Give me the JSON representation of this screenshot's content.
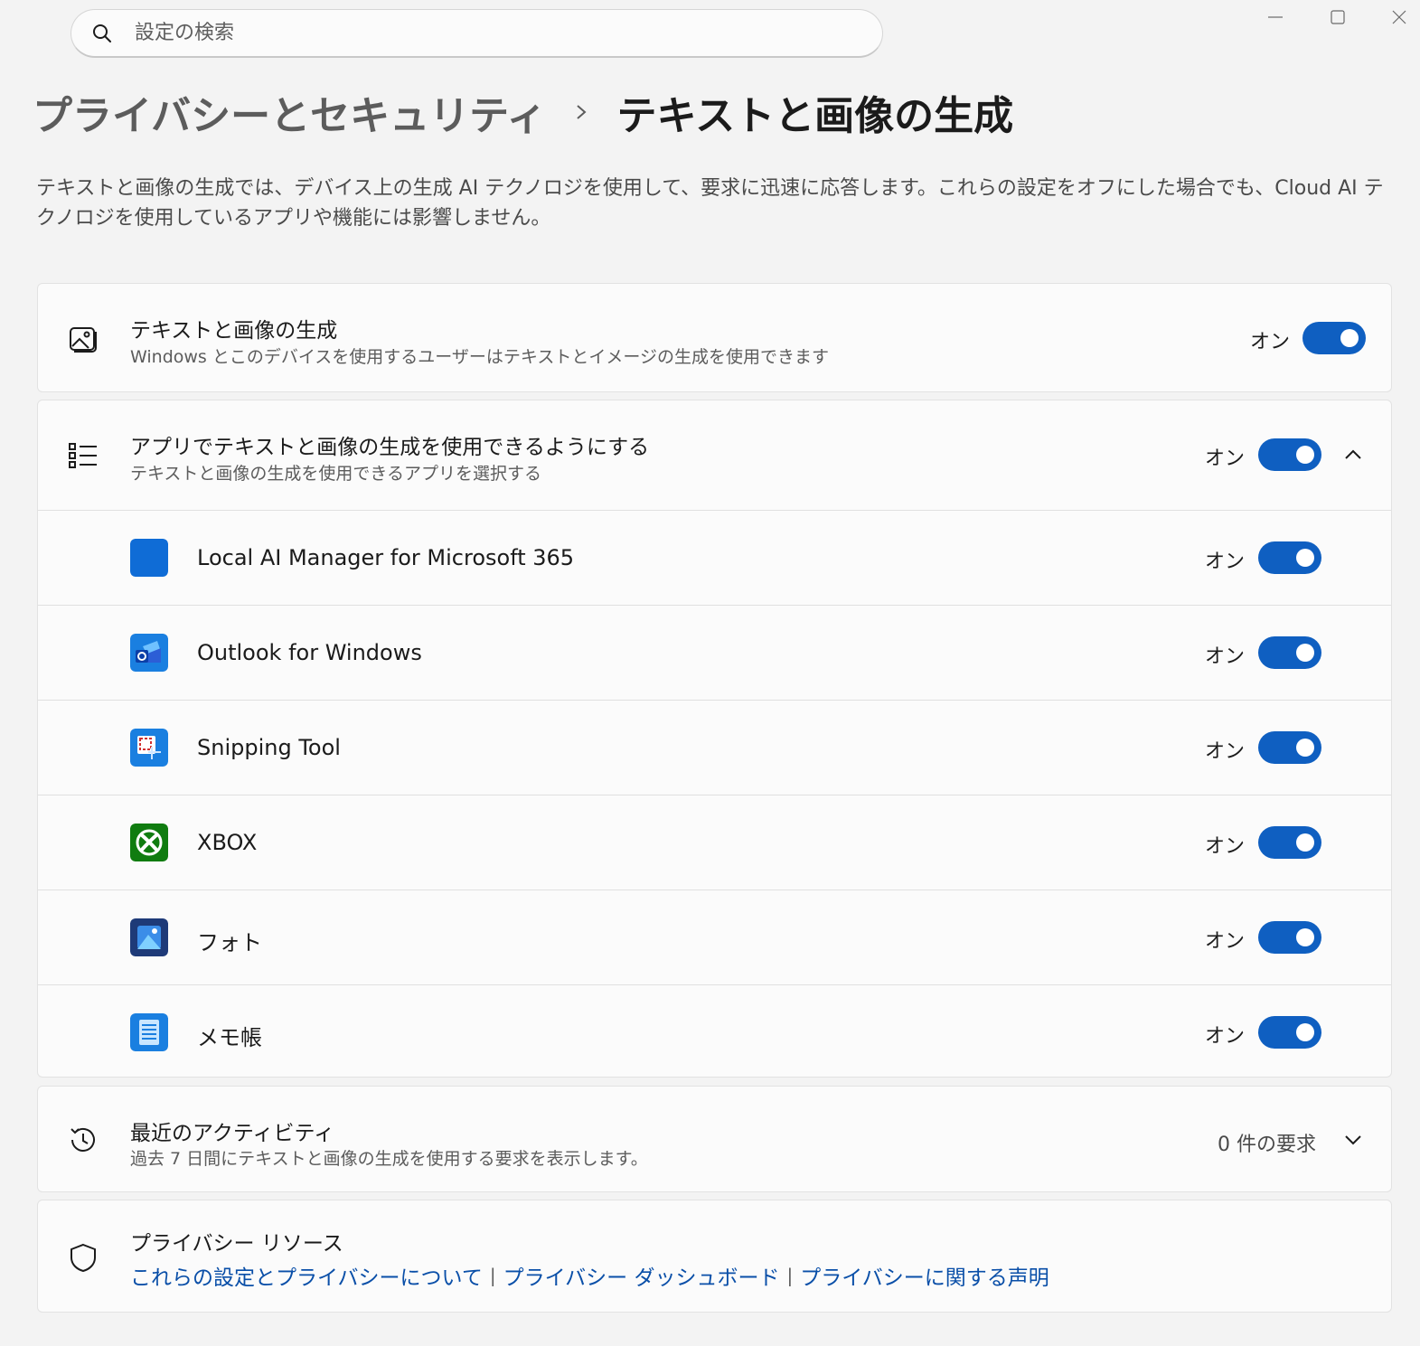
{
  "search": {
    "placeholder": "設定の検索",
    "icon": "search-icon"
  },
  "window_controls": [
    "minimize-icon",
    "maximize-icon",
    "close-icon"
  ],
  "breadcrumb": {
    "parent": "プライバシーとセキュリティ",
    "separator_icon": "chevron-right-icon",
    "current": "テキストと画像の生成"
  },
  "description": "テキストと画像の生成では、デバイス上の生成 AI テクノロジを使用して、要求に迅速に応答します。これらの設定をオフにした場合でも、Cloud AI テクノロジを使用しているアプリや機能には影響しません。",
  "accent_color": "#0f5fc1",
  "main_setting": {
    "icon": "image-icon",
    "title": "テキストと画像の生成",
    "subtitle": "Windows とこのデバイスを使用するユーザーはテキストとイメージの生成を使用できます",
    "state": "オン",
    "enabled": true
  },
  "apps_setting": {
    "icon": "list-icon",
    "title": "アプリでテキストと画像の生成を使用できるようにする",
    "subtitle": "テキストと画像の生成を使用できるアプリを選択する",
    "state": "オン",
    "enabled": true,
    "expanded": true,
    "apps": [
      {
        "name": "Local AI Manager for Microsoft 365",
        "icon": "local-ai-manager-icon",
        "state": "オン",
        "enabled": true
      },
      {
        "name": "Outlook for Windows",
        "icon": "outlook-icon",
        "state": "オン",
        "enabled": true
      },
      {
        "name": "Snipping Tool",
        "icon": "snipping-tool-icon",
        "state": "オン",
        "enabled": true
      },
      {
        "name": "XBOX",
        "icon": "xbox-icon",
        "state": "オン",
        "enabled": true
      },
      {
        "name": "フォト",
        "icon": "photos-icon",
        "state": "オン",
        "enabled": true
      },
      {
        "name": "メモ帳",
        "icon": "notepad-icon",
        "state": "オン",
        "enabled": true
      }
    ]
  },
  "recent_activity": {
    "icon": "history-icon",
    "title": "最近のアクティビティ",
    "subtitle": "過去 7 日間にテキストと画像の生成を使用する要求を表示します。",
    "value": "0 件の要求"
  },
  "privacy_resources": {
    "icon": "shield-icon",
    "title": "プライバシー リソース",
    "links": [
      "これらの設定とプライバシーについて",
      "プライバシー ダッシュボード",
      "プライバシーに関する声明"
    ]
  }
}
